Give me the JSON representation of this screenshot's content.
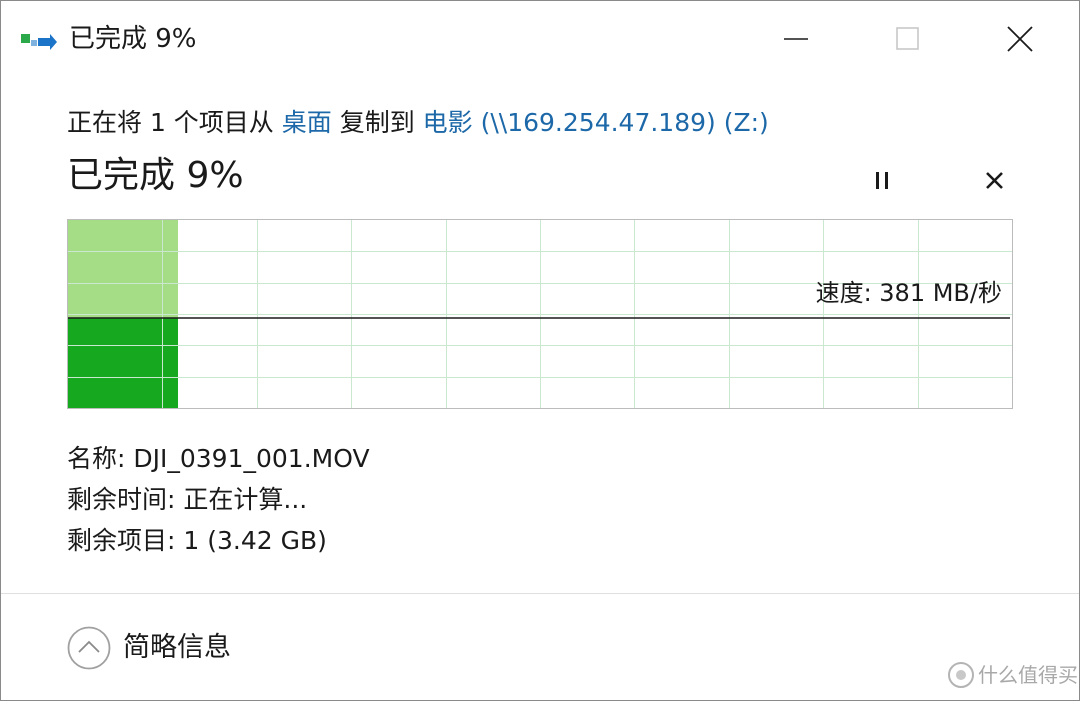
{
  "window": {
    "title": "已完成 9%",
    "app_icon": "file-copy-icon",
    "controls": {
      "minimize": "minimize-icon",
      "maximize": "maximize-icon",
      "close": "close-icon"
    }
  },
  "operation": {
    "prefix": "正在将 1 个项目从 ",
    "source": "桌面",
    "middle": " 复制到 ",
    "destination": "电影 (\\\\169.254.47.189) (Z:)"
  },
  "progress": {
    "label": "已完成 9%",
    "percent": 9,
    "pause_icon": "pause-icon",
    "cancel_icon": "cancel-icon",
    "speed_label": "速度: 381 MB/秒",
    "colors": {
      "completed_fill": "#a5dc86",
      "speed_fill": "#16a81e",
      "grid": "#c9e8cf",
      "speed_line": "#1a1a1a"
    }
  },
  "details": {
    "name": "名称: DJI_0391_001.MOV",
    "time_remaining": "剩余时间: 正在计算...",
    "items_remaining": "剩余项目: 1 (3.42 GB)"
  },
  "footer": {
    "toggle_icon": "chevron-up-icon",
    "toggle_label": "简略信息"
  },
  "watermark": {
    "text": "什么值得买"
  }
}
